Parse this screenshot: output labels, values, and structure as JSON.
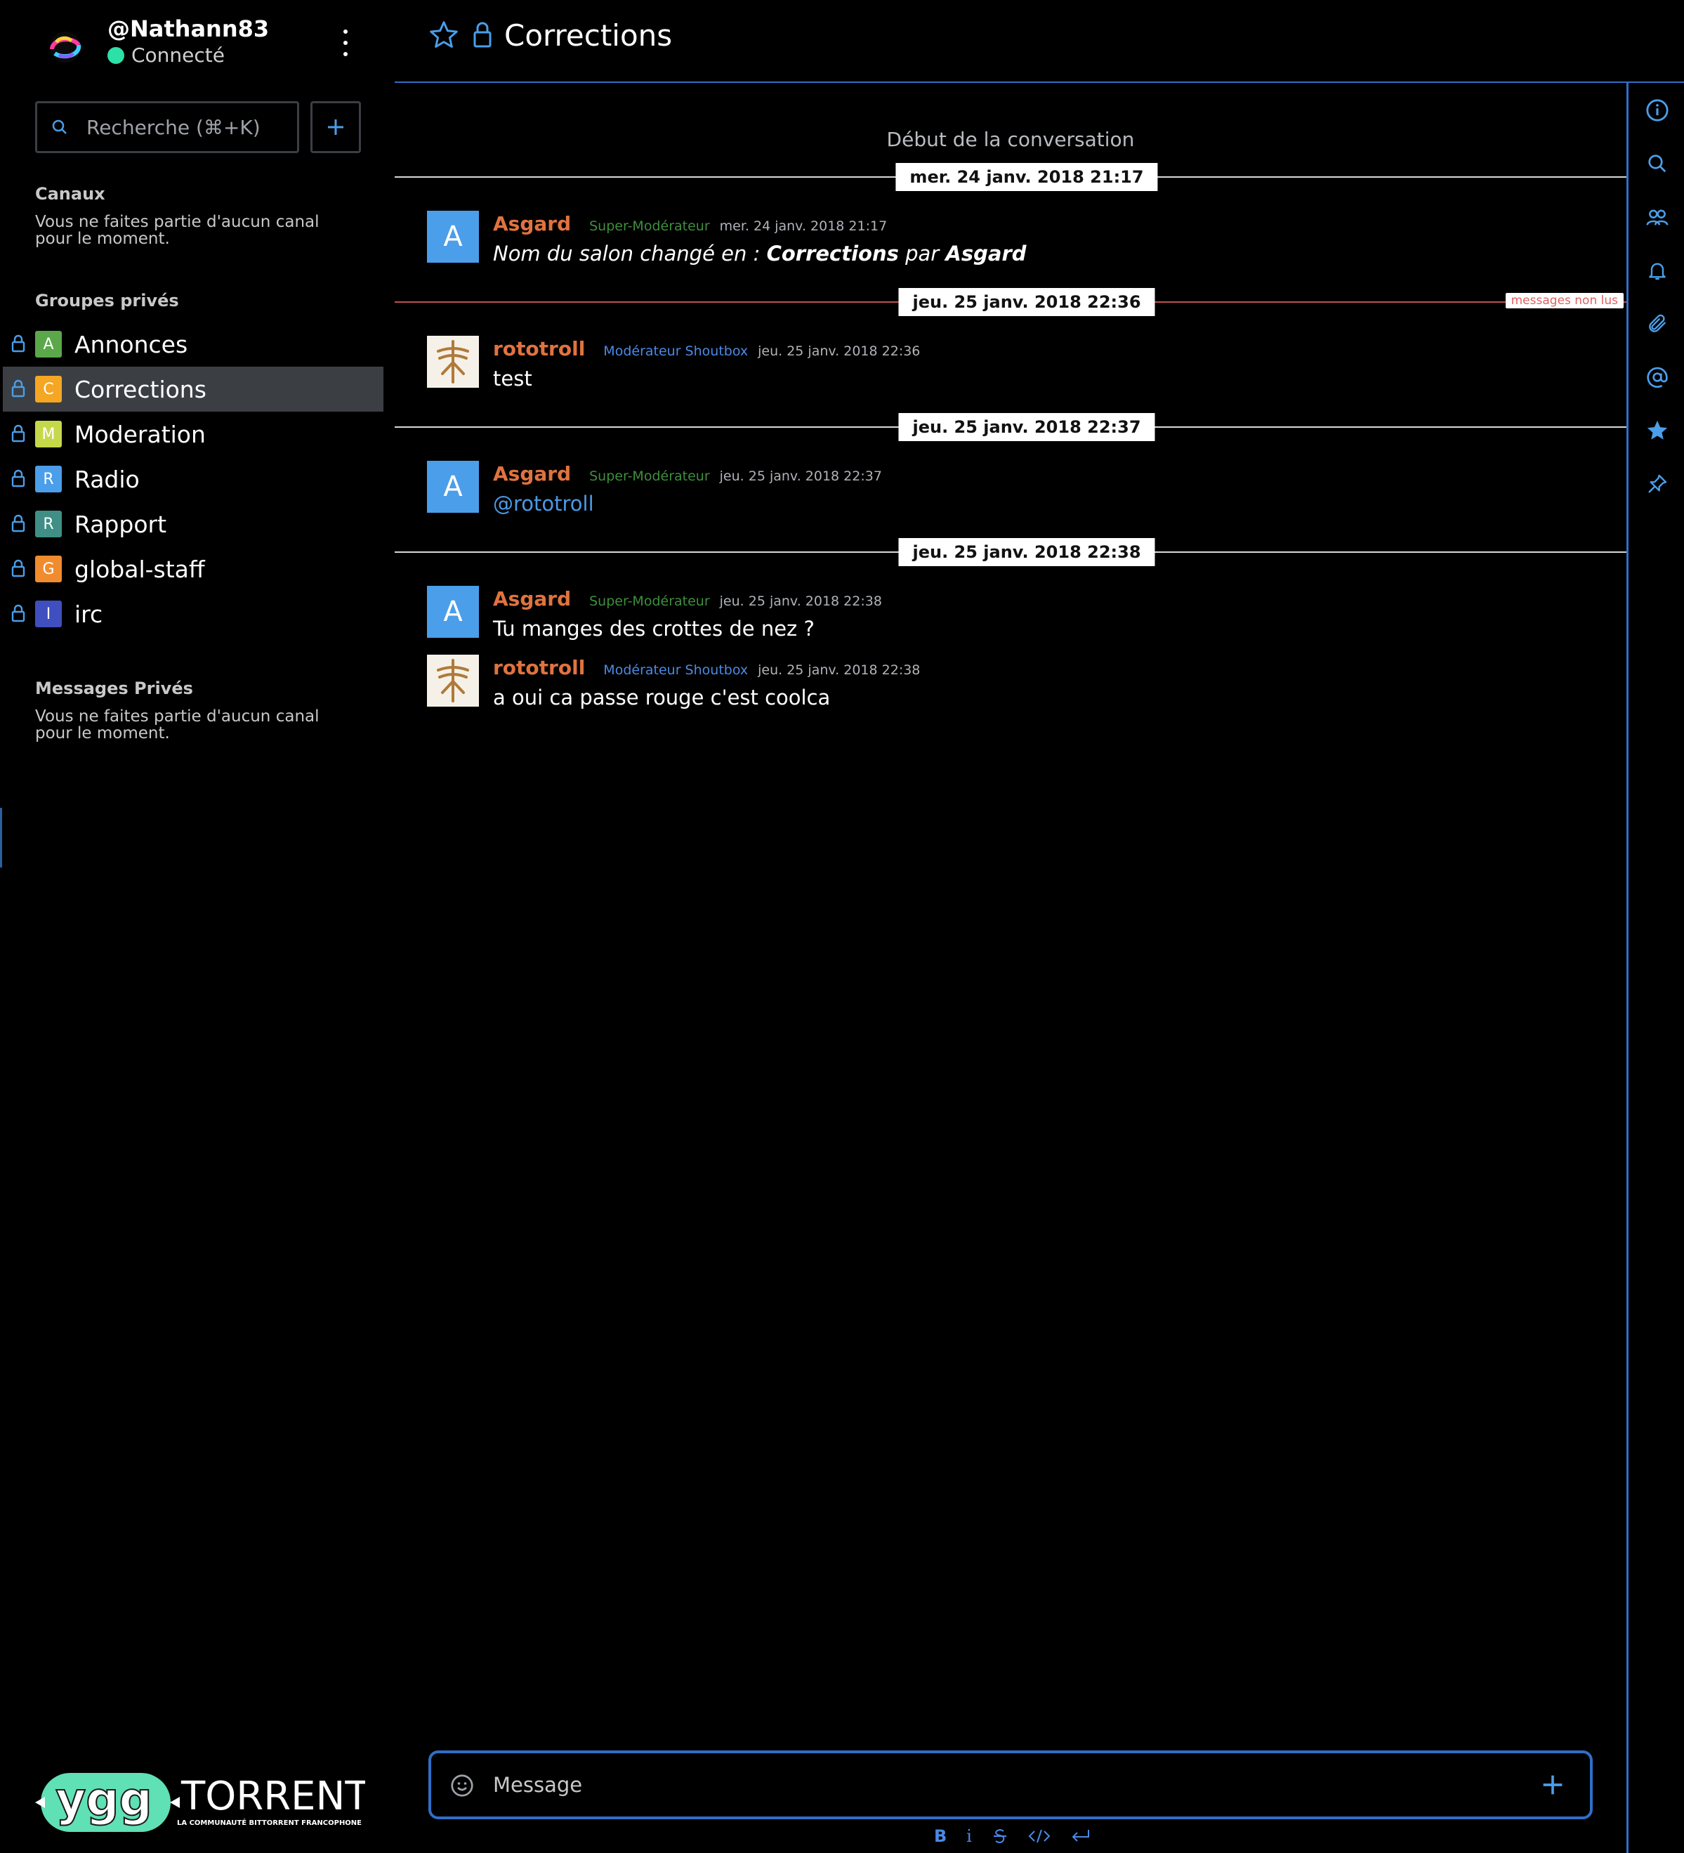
{
  "user": {
    "name": "@Nathann83",
    "status": "Connecté"
  },
  "search": {
    "placeholder": "Recherche (⌘+K)"
  },
  "sidebar": {
    "channels_title": "Canaux",
    "channels_empty": "Vous ne faites partie d'aucun canal pour le moment.",
    "groups_title": "Groupes privés",
    "groups": [
      {
        "initial": "A",
        "name": "Annonces",
        "color": "#5aa84a",
        "active": false
      },
      {
        "initial": "C",
        "name": "Corrections",
        "color": "#f5a623",
        "active": true
      },
      {
        "initial": "M",
        "name": "Moderation",
        "color": "#c5d84a",
        "active": false
      },
      {
        "initial": "R",
        "name": "Radio",
        "color": "#4b9ee9",
        "active": false
      },
      {
        "initial": "R",
        "name": "Rapport",
        "color": "#3f8f86",
        "active": false
      },
      {
        "initial": "G",
        "name": "global-staff",
        "color": "#f08c2e",
        "active": false
      },
      {
        "initial": "I",
        "name": "irc",
        "color": "#3f4fbf",
        "active": false
      }
    ],
    "dm_title": "Messages Privés",
    "dm_empty": "Vous ne faites partie d'aucun canal pour le moment."
  },
  "logo": {
    "brand": "ygg",
    "word": "TORRENT",
    "tagline": "LA COMMUNAUTÉ BITTORRENT FRANCOPHONE"
  },
  "header": {
    "title": "Corrections"
  },
  "toolbar_icons": [
    "info-icon",
    "search-icon",
    "members-icon",
    "bell-icon",
    "paperclip-icon",
    "at-icon",
    "star-icon",
    "pin-icon"
  ],
  "conversation": {
    "start_label": "Début de la conversation",
    "unread_label": "messages non lus",
    "dates": [
      "mer. 24 janv. 2018 21:17",
      "jeu. 25 janv. 2018 22:36",
      "jeu. 25 janv. 2018 22:37",
      "jeu. 25 janv. 2018 22:38"
    ],
    "messages": [
      {
        "author": "Asgard",
        "role": "Super-Modérateur",
        "time": "mer. 24 janv. 2018 21:17",
        "system": {
          "prefix": "Nom du salon changé en : ",
          "room": "Corrections",
          "by": " par ",
          "user": "Asgard"
        }
      },
      {
        "author": "rototroll",
        "role": "Modérateur Shoutbox",
        "time": "jeu. 25 janv. 2018 22:36",
        "text": "test"
      },
      {
        "author": "Asgard",
        "role": "Super-Modérateur",
        "time": "jeu. 25 janv. 2018 22:37",
        "text": "@rototroll"
      },
      {
        "author": "Asgard",
        "role": "Super-Modérateur",
        "time": "jeu. 25 janv. 2018 22:38",
        "text": "Tu manges des crottes de nez ?"
      },
      {
        "author": "rototroll",
        "role": "Modérateur Shoutbox",
        "time": "jeu. 25 janv. 2018 22:38",
        "text": "a oui ca passe rouge c'est coolca"
      }
    ]
  },
  "composer": {
    "placeholder": "Message",
    "format": {
      "bold": "B",
      "italic": "i"
    }
  },
  "colors": {
    "accent": "#2f6fc7",
    "author": "#e0733f",
    "role_super": "#3d8f3d",
    "role_shout": "#4a8ae6",
    "online": "#2de0a7",
    "unread": "#c05050"
  }
}
